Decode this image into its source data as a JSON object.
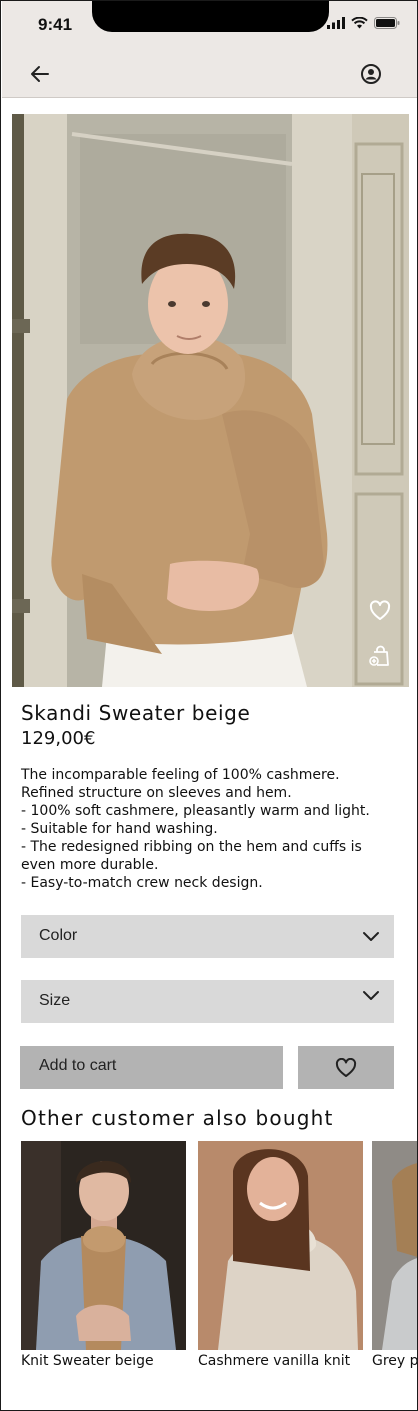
{
  "status_bar": {
    "time": "9:41"
  },
  "header": {
    "back_icon": "arrow-left-icon",
    "profile_icon": "user-circle-icon"
  },
  "hero": {
    "favorite_icon": "heart-icon",
    "add_to_bag_icon": "shopping-bag-plus-icon"
  },
  "product": {
    "name": "Skandi Sweater beige",
    "price": "129,00€",
    "description": [
      "The incomparable feeling of 100% cashmere.",
      "Refined structure on sleeves and hem.",
      "- 100% soft cashmere, pleasantly warm and light.",
      "- Suitable for hand washing.",
      "- The redesigned ribbing on the hem and cuffs is",
      "even more durable.",
      "- Easy-to-match crew neck design."
    ]
  },
  "options": {
    "color_label": "Color",
    "size_label": "Size"
  },
  "actions": {
    "add_to_cart": "Add to cart",
    "wishlist_icon": "heart-icon"
  },
  "recommendations": {
    "title": "Other customer also bought",
    "items": [
      {
        "name": "Knit Sweater beige"
      },
      {
        "name": "Cashmere vanilla knit"
      },
      {
        "name": "Grey pullover"
      }
    ]
  },
  "colors": {
    "header_bg": "#ece8e5",
    "select_bg": "#d9d9d9",
    "button_bg": "#b3b3b3",
    "sweater": "#c09a6f"
  }
}
